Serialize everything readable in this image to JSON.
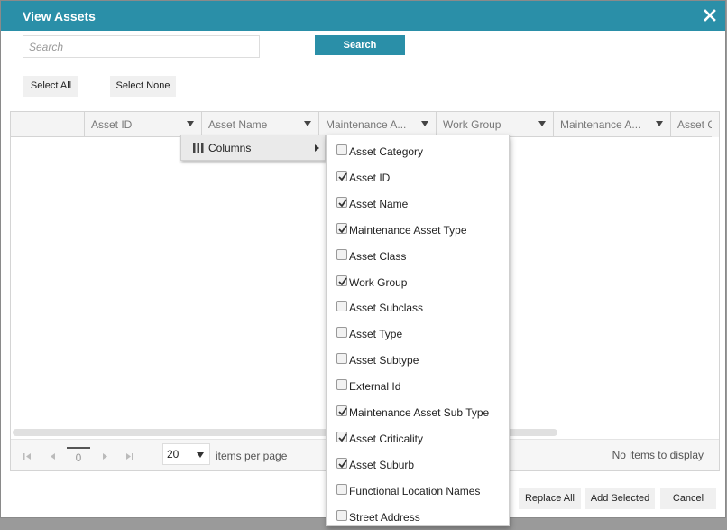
{
  "dialog": {
    "title": "View Assets"
  },
  "search": {
    "placeholder": "Search",
    "button_label": "Search"
  },
  "selection": {
    "select_all": "Select All",
    "select_none": "Select None"
  },
  "grid": {
    "columns": [
      "Asset ID",
      "Asset Name",
      "Maintenance A...",
      "Work Group",
      "Maintenance A...",
      "Asset C"
    ],
    "empty_message": "No items to display"
  },
  "pager": {
    "page": "0",
    "page_size": "20",
    "items_per_page_label": "items per page"
  },
  "column_menu": {
    "label": "Columns",
    "items": [
      {
        "label": "Asset Category",
        "checked": false
      },
      {
        "label": "Asset ID",
        "checked": true
      },
      {
        "label": "Asset Name",
        "checked": true
      },
      {
        "label": "Maintenance Asset Type",
        "checked": true
      },
      {
        "label": "Asset Class",
        "checked": false
      },
      {
        "label": "Work Group",
        "checked": true
      },
      {
        "label": "Asset Subclass",
        "checked": false
      },
      {
        "label": "Asset Type",
        "checked": false
      },
      {
        "label": "Asset Subtype",
        "checked": false
      },
      {
        "label": "External Id",
        "checked": false
      },
      {
        "label": "Maintenance Asset Sub Type",
        "checked": true
      },
      {
        "label": "Asset Criticality",
        "checked": true
      },
      {
        "label": "Asset Suburb",
        "checked": true
      },
      {
        "label": "Functional Location Names",
        "checked": false
      },
      {
        "label": "Street Address",
        "checked": false
      }
    ]
  },
  "footer": {
    "replace_all": "Replace All",
    "add_selected": "Add Selected",
    "cancel": "Cancel"
  },
  "colors": {
    "accent": "#2a8fa8"
  }
}
